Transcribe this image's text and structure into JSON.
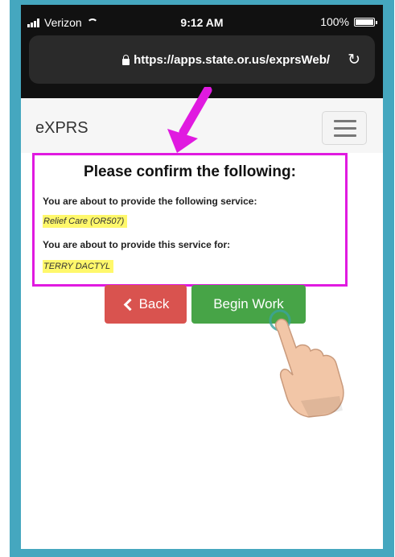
{
  "status_bar": {
    "carrier": "Verizon",
    "time": "9:12 AM",
    "battery": "100%"
  },
  "browser": {
    "url": "https://apps.state.or.us/exprsWeb/"
  },
  "navbar": {
    "brand": "eXPRS"
  },
  "confirm": {
    "title": "Please confirm the following:",
    "service_label": "You are about to provide the following service:",
    "service_value": "Relief Care (OR507)",
    "client_label": "You are about to provide this service for:",
    "client_value": "TERRY DACTYL"
  },
  "buttons": {
    "back": "Back",
    "begin": "Begin Work"
  },
  "colors": {
    "frame": "#45a7bf",
    "highlight_border": "#e01ae0",
    "back_button": "#d9534f",
    "begin_button": "#47a447",
    "text_highlight": "#fff86b"
  }
}
